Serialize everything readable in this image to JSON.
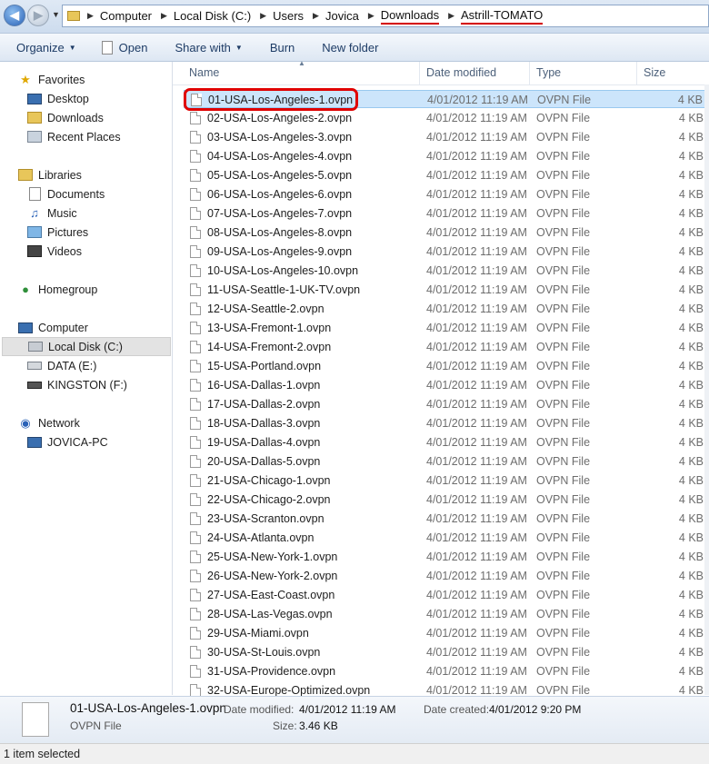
{
  "breadcrumb": [
    "Computer",
    "Local Disk (C:)",
    "Users",
    "Jovica",
    "Downloads",
    "Astrill-TOMATO"
  ],
  "toolbar": {
    "organize": "Organize",
    "open": "Open",
    "share_with": "Share with",
    "burn": "Burn",
    "new_folder": "New folder"
  },
  "nav": {
    "favorites": "Favorites",
    "desktop": "Desktop",
    "downloads": "Downloads",
    "recent_places": "Recent Places",
    "libraries": "Libraries",
    "documents": "Documents",
    "music": "Music",
    "pictures": "Pictures",
    "videos": "Videos",
    "homegroup": "Homegroup",
    "computer": "Computer",
    "local_disk": "Local Disk (C:)",
    "data_e": "DATA (E:)",
    "kingston_f": "KINGSTON (F:)",
    "network": "Network",
    "jovica_pc": "JOVICA-PC"
  },
  "columns": {
    "name": "Name",
    "date_modified": "Date modified",
    "type": "Type",
    "size": "Size"
  },
  "files": [
    {
      "name": "01-USA-Los-Angeles-1.ovpn",
      "date": "4/01/2012 11:19 AM",
      "type": "OVPN File",
      "size": "4 KB"
    },
    {
      "name": "02-USA-Los-Angeles-2.ovpn",
      "date": "4/01/2012 11:19 AM",
      "type": "OVPN File",
      "size": "4 KB"
    },
    {
      "name": "03-USA-Los-Angeles-3.ovpn",
      "date": "4/01/2012 11:19 AM",
      "type": "OVPN File",
      "size": "4 KB"
    },
    {
      "name": "04-USA-Los-Angeles-4.ovpn",
      "date": "4/01/2012 11:19 AM",
      "type": "OVPN File",
      "size": "4 KB"
    },
    {
      "name": "05-USA-Los-Angeles-5.ovpn",
      "date": "4/01/2012 11:19 AM",
      "type": "OVPN File",
      "size": "4 KB"
    },
    {
      "name": "06-USA-Los-Angeles-6.ovpn",
      "date": "4/01/2012 11:19 AM",
      "type": "OVPN File",
      "size": "4 KB"
    },
    {
      "name": "07-USA-Los-Angeles-7.ovpn",
      "date": "4/01/2012 11:19 AM",
      "type": "OVPN File",
      "size": "4 KB"
    },
    {
      "name": "08-USA-Los-Angeles-8.ovpn",
      "date": "4/01/2012 11:19 AM",
      "type": "OVPN File",
      "size": "4 KB"
    },
    {
      "name": "09-USA-Los-Angeles-9.ovpn",
      "date": "4/01/2012 11:19 AM",
      "type": "OVPN File",
      "size": "4 KB"
    },
    {
      "name": "10-USA-Los-Angeles-10.ovpn",
      "date": "4/01/2012 11:19 AM",
      "type": "OVPN File",
      "size": "4 KB"
    },
    {
      "name": "11-USA-Seattle-1-UK-TV.ovpn",
      "date": "4/01/2012 11:19 AM",
      "type": "OVPN File",
      "size": "4 KB"
    },
    {
      "name": "12-USA-Seattle-2.ovpn",
      "date": "4/01/2012 11:19 AM",
      "type": "OVPN File",
      "size": "4 KB"
    },
    {
      "name": "13-USA-Fremont-1.ovpn",
      "date": "4/01/2012 11:19 AM",
      "type": "OVPN File",
      "size": "4 KB"
    },
    {
      "name": "14-USA-Fremont-2.ovpn",
      "date": "4/01/2012 11:19 AM",
      "type": "OVPN File",
      "size": "4 KB"
    },
    {
      "name": "15-USA-Portland.ovpn",
      "date": "4/01/2012 11:19 AM",
      "type": "OVPN File",
      "size": "4 KB"
    },
    {
      "name": "16-USA-Dallas-1.ovpn",
      "date": "4/01/2012 11:19 AM",
      "type": "OVPN File",
      "size": "4 KB"
    },
    {
      "name": "17-USA-Dallas-2.ovpn",
      "date": "4/01/2012 11:19 AM",
      "type": "OVPN File",
      "size": "4 KB"
    },
    {
      "name": "18-USA-Dallas-3.ovpn",
      "date": "4/01/2012 11:19 AM",
      "type": "OVPN File",
      "size": "4 KB"
    },
    {
      "name": "19-USA-Dallas-4.ovpn",
      "date": "4/01/2012 11:19 AM",
      "type": "OVPN File",
      "size": "4 KB"
    },
    {
      "name": "20-USA-Dallas-5.ovpn",
      "date": "4/01/2012 11:19 AM",
      "type": "OVPN File",
      "size": "4 KB"
    },
    {
      "name": "21-USA-Chicago-1.ovpn",
      "date": "4/01/2012 11:19 AM",
      "type": "OVPN File",
      "size": "4 KB"
    },
    {
      "name": "22-USA-Chicago-2.ovpn",
      "date": "4/01/2012 11:19 AM",
      "type": "OVPN File",
      "size": "4 KB"
    },
    {
      "name": "23-USA-Scranton.ovpn",
      "date": "4/01/2012 11:19 AM",
      "type": "OVPN File",
      "size": "4 KB"
    },
    {
      "name": "24-USA-Atlanta.ovpn",
      "date": "4/01/2012 11:19 AM",
      "type": "OVPN File",
      "size": "4 KB"
    },
    {
      "name": "25-USA-New-York-1.ovpn",
      "date": "4/01/2012 11:19 AM",
      "type": "OVPN File",
      "size": "4 KB"
    },
    {
      "name": "26-USA-New-York-2.ovpn",
      "date": "4/01/2012 11:19 AM",
      "type": "OVPN File",
      "size": "4 KB"
    },
    {
      "name": "27-USA-East-Coast.ovpn",
      "date": "4/01/2012 11:19 AM",
      "type": "OVPN File",
      "size": "4 KB"
    },
    {
      "name": "28-USA-Las-Vegas.ovpn",
      "date": "4/01/2012 11:19 AM",
      "type": "OVPN File",
      "size": "4 KB"
    },
    {
      "name": "29-USA-Miami.ovpn",
      "date": "4/01/2012 11:19 AM",
      "type": "OVPN File",
      "size": "4 KB"
    },
    {
      "name": "30-USA-St-Louis.ovpn",
      "date": "4/01/2012 11:19 AM",
      "type": "OVPN File",
      "size": "4 KB"
    },
    {
      "name": "31-USA-Providence.ovpn",
      "date": "4/01/2012 11:19 AM",
      "type": "OVPN File",
      "size": "4 KB"
    },
    {
      "name": "32-USA-Europe-Optimized.ovpn",
      "date": "4/01/2012 11:19 AM",
      "type": "OVPN File",
      "size": "4 KB"
    }
  ],
  "details": {
    "filename": "01-USA-Los-Angeles-1.ovpn",
    "filetype": "OVPN File",
    "date_modified_label": "Date modified:",
    "date_modified": "4/01/2012 11:19 AM",
    "date_created_label": "Date created:",
    "date_created": "4/01/2012 9:20 PM",
    "size_label": "Size:",
    "size": "3.46 KB"
  },
  "status": {
    "text": "1 item selected"
  },
  "colors": {
    "highlight_red": "#e00000",
    "selection_blue": "#cce5fb"
  }
}
